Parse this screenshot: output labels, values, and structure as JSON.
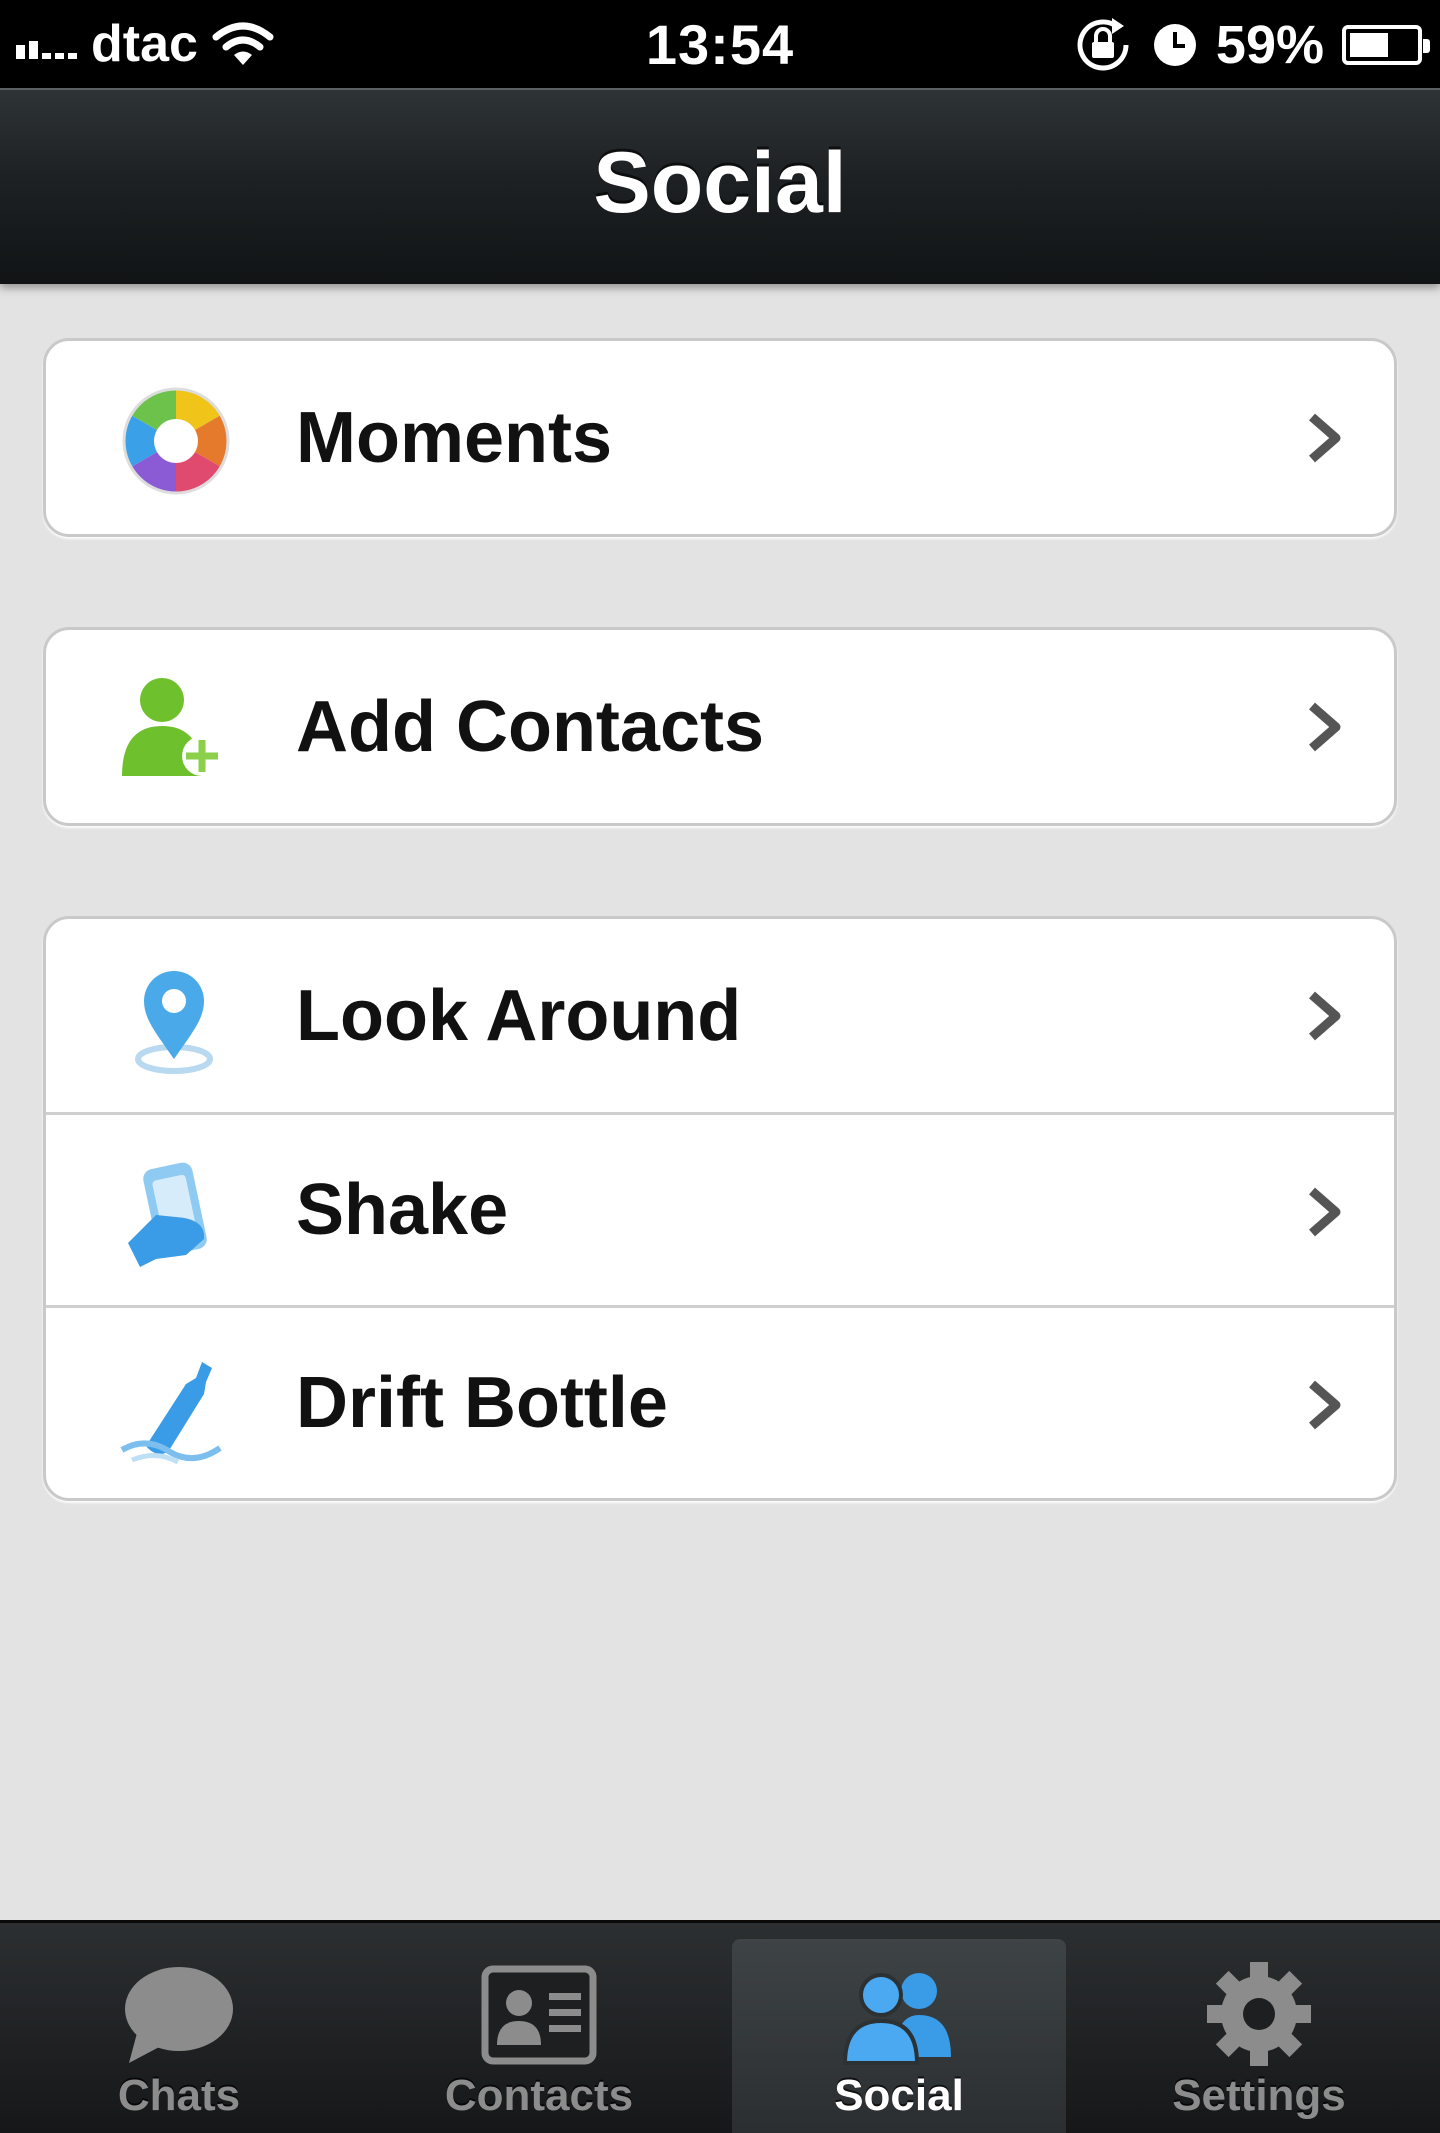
{
  "status_bar": {
    "carrier": "dtac",
    "time": "13:54",
    "battery_percent_text": "59%",
    "battery_level": 0.59,
    "icons": [
      "signal-icon",
      "wifi-icon",
      "rotation-lock-icon",
      "alarm-icon",
      "battery-icon"
    ]
  },
  "nav": {
    "title": "Social"
  },
  "groups": [
    {
      "rows": [
        {
          "label": "Moments",
          "icon": "moments-aperture-icon"
        }
      ]
    },
    {
      "rows": [
        {
          "label": "Add Contacts",
          "icon": "add-contact-icon"
        }
      ]
    },
    {
      "rows": [
        {
          "label": "Look Around",
          "icon": "location-pin-icon"
        },
        {
          "label": "Shake",
          "icon": "shake-phone-icon"
        },
        {
          "label": "Drift Bottle",
          "icon": "drift-bottle-icon"
        }
      ]
    }
  ],
  "tab_bar": {
    "active": "Social",
    "tabs": [
      {
        "label": "Chats",
        "icon": "chat-bubble-icon"
      },
      {
        "label": "Contacts",
        "icon": "contact-card-icon"
      },
      {
        "label": "Social",
        "icon": "people-icon"
      },
      {
        "label": "Settings",
        "icon": "gear-icon"
      }
    ]
  },
  "colors": {
    "accent_blue": "#3a9be6",
    "background": "#e3e3e3"
  }
}
